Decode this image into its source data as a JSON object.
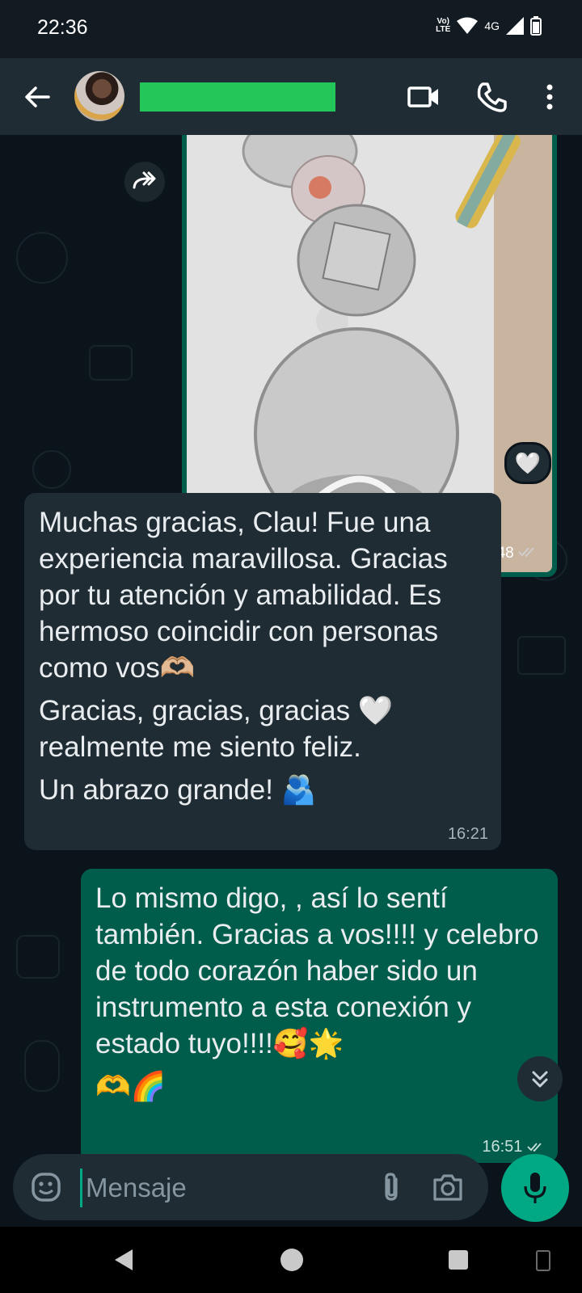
{
  "status_bar": {
    "time": "22:36",
    "network": "4G",
    "volte_line1": "Vo)",
    "volte_line2": "LTE"
  },
  "header": {
    "contact_name": ""
  },
  "messages": {
    "photo": {
      "time": "14:48",
      "reaction": "🤍"
    },
    "incoming": {
      "line1": "Muchas gracias, Clau! Fue una experiencia maravillosa. Gracias por tu atención y amabilidad. Es hermoso coincidir con personas como vos🫶🏼",
      "line2": "Gracias, gracias, gracias 🤍",
      "line3": "realmente me siento feliz.",
      "line4": "  Un abrazo grande! 🫂",
      "time": "16:21"
    },
    "outgoing": {
      "text": "Lo mismo digo, , así lo sentí también. Gracias a vos!!!! y celebro de todo corazón haber sido un instrumento a esta conexión y estado tuyo!!!!🥰🌟",
      "text2": "🫶🌈",
      "time": "16:51"
    }
  },
  "composer": {
    "placeholder": "Mensaje"
  },
  "colors": {
    "outgoing_bubble": "#005c4b",
    "incoming_bubble": "#1f2c34",
    "accent": "#00a884",
    "header": "#1f2c34"
  }
}
